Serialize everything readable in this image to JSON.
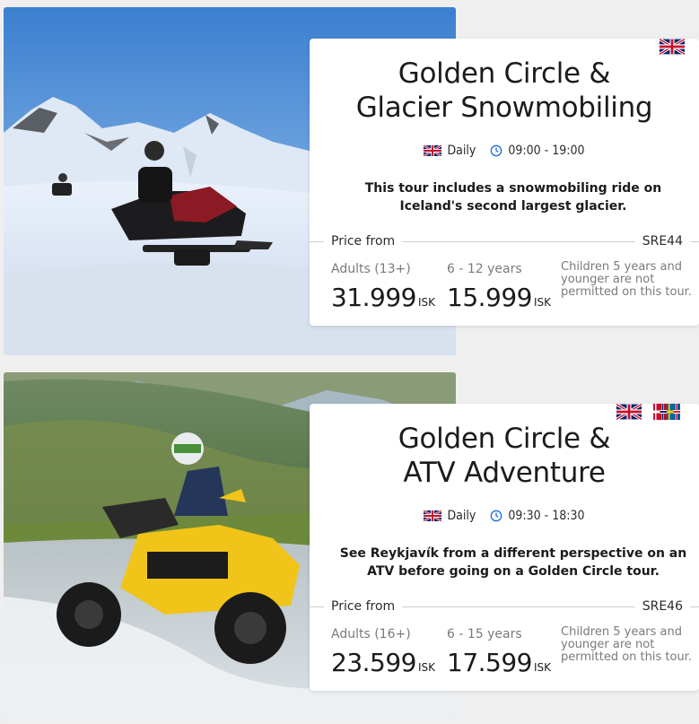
{
  "tours": [
    {
      "title_line1": "Golden Circle &",
      "title_line2": "Glacier Snowmobiling",
      "schedule": "Daily",
      "time": "09:00 - 19:00",
      "description": "This tour includes a snowmobiling ride on Iceland's second largest glacier.",
      "price_label": "Price from",
      "code": "SRE44",
      "adult_label": "Adults (13+)",
      "adult_price": "31.999",
      "child_label": "6 - 12 years",
      "child_price": "15.999",
      "currency": "ISK",
      "note": "Children 5 years and younger are not permitted on this tour.",
      "flags": [
        "uk-flag"
      ]
    },
    {
      "title_line1": "Golden Circle &",
      "title_line2": "ATV Adventure",
      "schedule": "Daily",
      "time": "09:30 - 18:30",
      "description": "See Reykjavík from a different perspective on an ATV before going on a Golden Circle tour.",
      "price_label": "Price from",
      "code": "SRE46",
      "adult_label": "Adults (16+)",
      "adult_price": "23.599",
      "child_label": "6 - 15 years",
      "child_price": "17.599",
      "currency": "ISK",
      "note": "Children 5 years and younger are not permitted on this tour.",
      "flags": [
        "uk-flag",
        "nordic-flags"
      ]
    }
  ],
  "colors": {
    "background": "#efefef",
    "panel": "#ffffff",
    "muted": "#7a7a7a",
    "text": "#1b1b1b"
  }
}
